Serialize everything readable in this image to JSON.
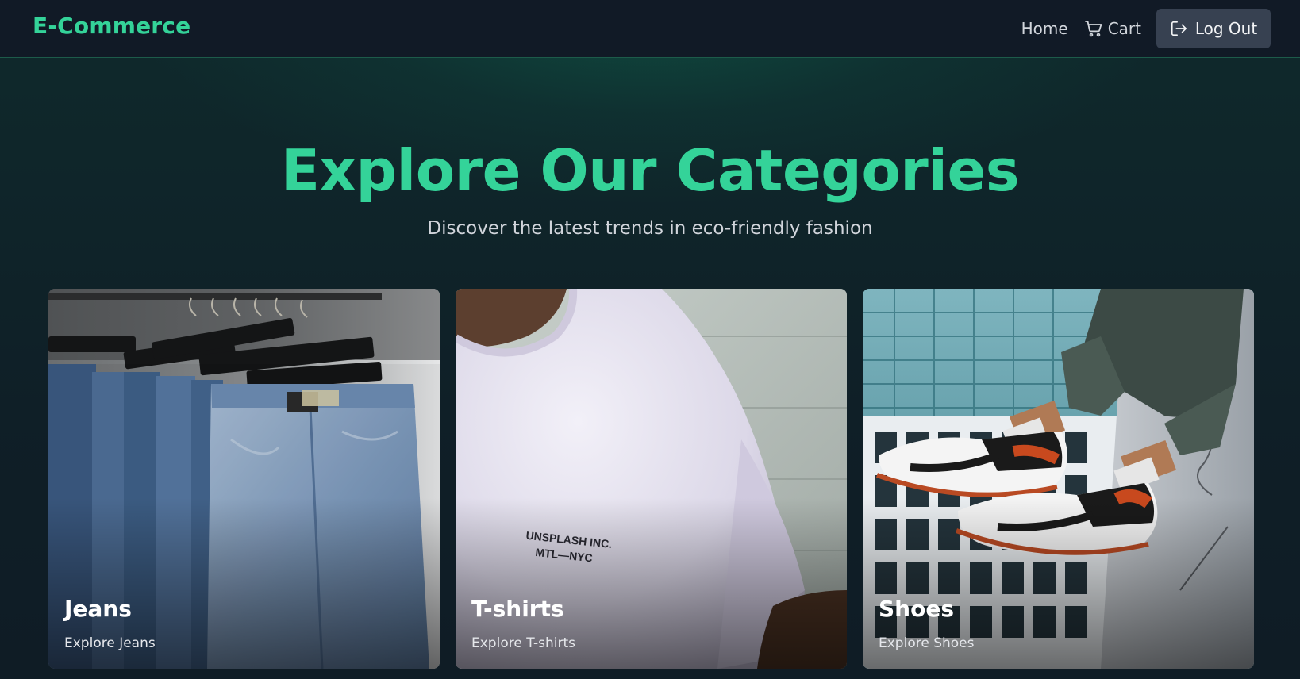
{
  "navbar": {
    "brand": "E-Commerce",
    "links": {
      "home": "Home",
      "cart": "Cart"
    },
    "logout_label": "Log Out",
    "icons": {
      "cart": "shopping-cart-icon",
      "logout": "log-out-icon"
    }
  },
  "hero": {
    "title": "Explore Our Categories",
    "subtitle": "Discover the latest trends in eco-friendly fashion"
  },
  "categories": [
    {
      "name": "Jeans",
      "link_label": "Explore Jeans",
      "print_text": ""
    },
    {
      "name": "T-shirts",
      "link_label": "Explore T-shirts",
      "print_text": "UNSPLASH INC.\nMTL—NYC"
    },
    {
      "name": "Shoes",
      "link_label": "Explore Shoes",
      "print_text": ""
    }
  ],
  "colors": {
    "accent": "#34d399",
    "navbar_bg": "#111a26",
    "page_bg": "#0f1d24",
    "button_bg": "#374151"
  }
}
